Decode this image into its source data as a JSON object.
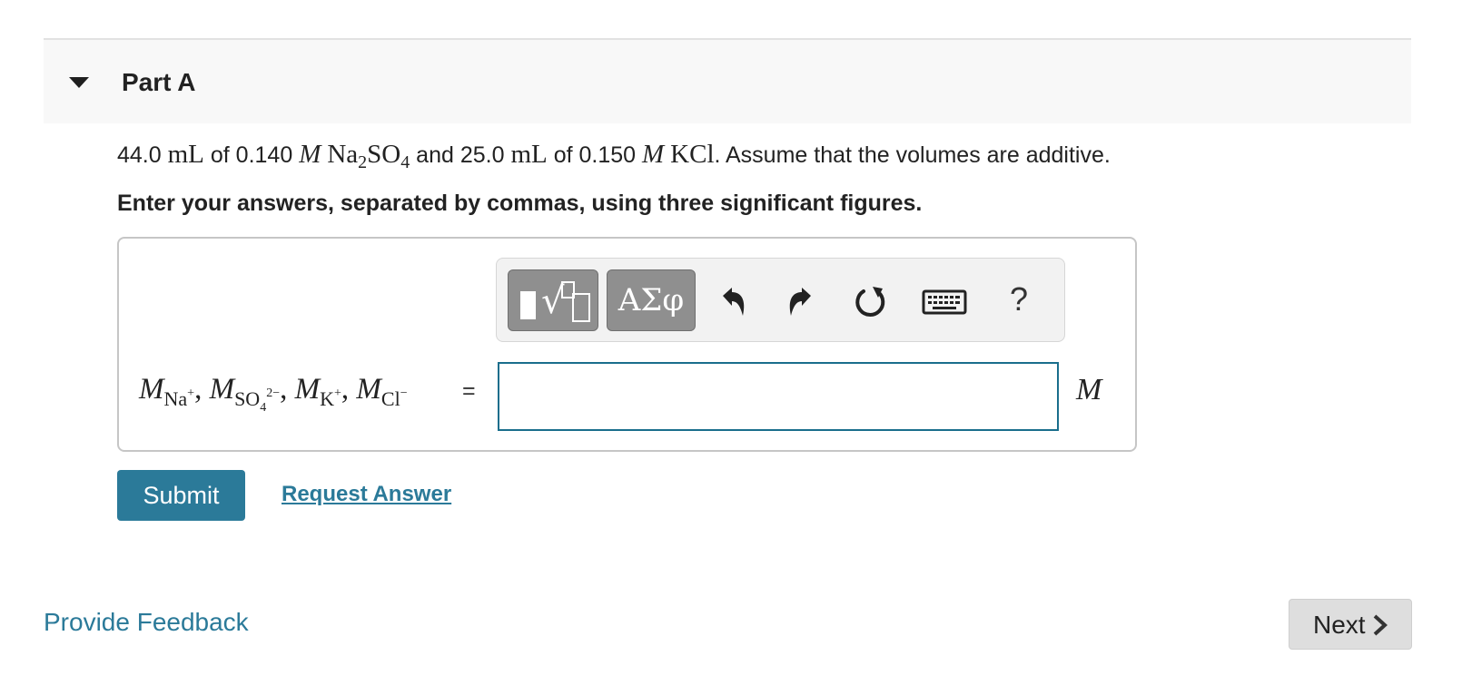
{
  "part": {
    "title": "Part A",
    "collapse_icon": "caret-down-icon"
  },
  "question": {
    "v1": "44.0",
    "unit_ml": "mL",
    "of": "of",
    "c1": "0.140",
    "molar": "M",
    "na": "Na",
    "na_sub": "2",
    "so": "SO",
    "so_sub": "4",
    "and": "and",
    "v2": "25.0",
    "c2": "0.150",
    "kcl": "KCl",
    "tail": ". Assume that the volumes are additive."
  },
  "instruction": "Enter your answers, separated by commas, using three significant figures.",
  "toolbar": {
    "templates_icon": "templates-radical-icon",
    "symbols_label": "ΑΣφ",
    "undo_icon": "undo-icon",
    "redo_icon": "redo-icon",
    "reset_icon": "reset-icon",
    "keyboard_icon": "keyboard-icon",
    "help_label": "?"
  },
  "answer": {
    "var": "M",
    "s1": "Na",
    "s1_sup": "+",
    "s2": "SO",
    "s2_sub": "4",
    "s2_sup": "2−",
    "s3": "K",
    "s3_sup": "+",
    "s4": "Cl",
    "s4_sup": "−",
    "sep": ",",
    "equals": "=",
    "value": "",
    "unit": "M"
  },
  "actions": {
    "submit_label": "Submit",
    "request_label": "Request Answer"
  },
  "footer": {
    "feedback_label": "Provide Feedback",
    "next_label": "Next",
    "next_icon": "chevron-right-icon"
  },
  "colors": {
    "accent": "#2b7a99",
    "input_border": "#1a6e8c",
    "header_bg": "#f8f8f8",
    "toolbar_button": "#8f8f8f"
  }
}
